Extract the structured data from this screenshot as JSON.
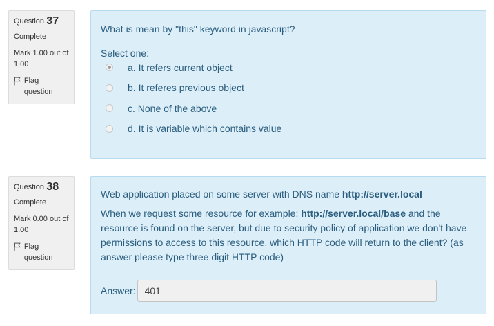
{
  "questions": [
    {
      "label": "Question",
      "number": "37",
      "state": "Complete",
      "grade": "Mark 1.00 out of 1.00",
      "flag_label": "Flag question",
      "text": "What is mean by \"this\" keyword in javascript?",
      "prompt": "Select one:",
      "options": [
        {
          "text": "a. It refers current object",
          "checked": true
        },
        {
          "text": "b. It referes previous object",
          "checked": false
        },
        {
          "text": "c. None of the above",
          "checked": false
        },
        {
          "text": "d. It is variable which contains value",
          "checked": false
        }
      ]
    },
    {
      "label": "Question",
      "number": "38",
      "state": "Complete",
      "grade": "Mark 0.00 out of 1.00",
      "flag_label": "Flag question",
      "text1_prefix": "Web application placed on some server with DNS name ",
      "text1_bold": "http://server.local",
      "text2_prefix": "When we request some resource for example: ",
      "text2_bold": "http://server.local/base",
      "text2_suffix": " and the resource is found on the server, but due to security policy of application we don't have permissions to access to this resource, which HTTP code will return to the client? (as answer please type three digit HTTP code)",
      "answer_label": "Answer:",
      "answer_value": "401"
    }
  ],
  "colors": {
    "content_bg": "#dceef8",
    "content_border": "#b9dbef",
    "info_bg": "#f0f0f0",
    "text": "#2b5d7e"
  },
  "icons": {
    "flag": "flag-icon"
  }
}
